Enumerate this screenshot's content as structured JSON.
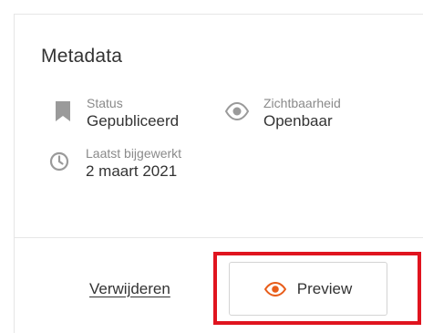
{
  "metadata": {
    "title": "Metadata",
    "status": {
      "label": "Status",
      "value": "Gepubliceerd",
      "icon": "bookmark-icon"
    },
    "visibility": {
      "label": "Zichtbaarheid",
      "value": "Openbaar",
      "icon": "eye-icon"
    },
    "updated": {
      "label": "Laatst bijgewerkt",
      "value": "2 maart 2021",
      "icon": "clock-icon"
    }
  },
  "actions": {
    "delete_label": "Verwijderen",
    "preview_label": "Preview",
    "preview_icon": "eye-icon"
  },
  "colors": {
    "icon_gray": "#9a9a9a",
    "accent": "#e85d1a",
    "highlight": "#e0141f"
  }
}
